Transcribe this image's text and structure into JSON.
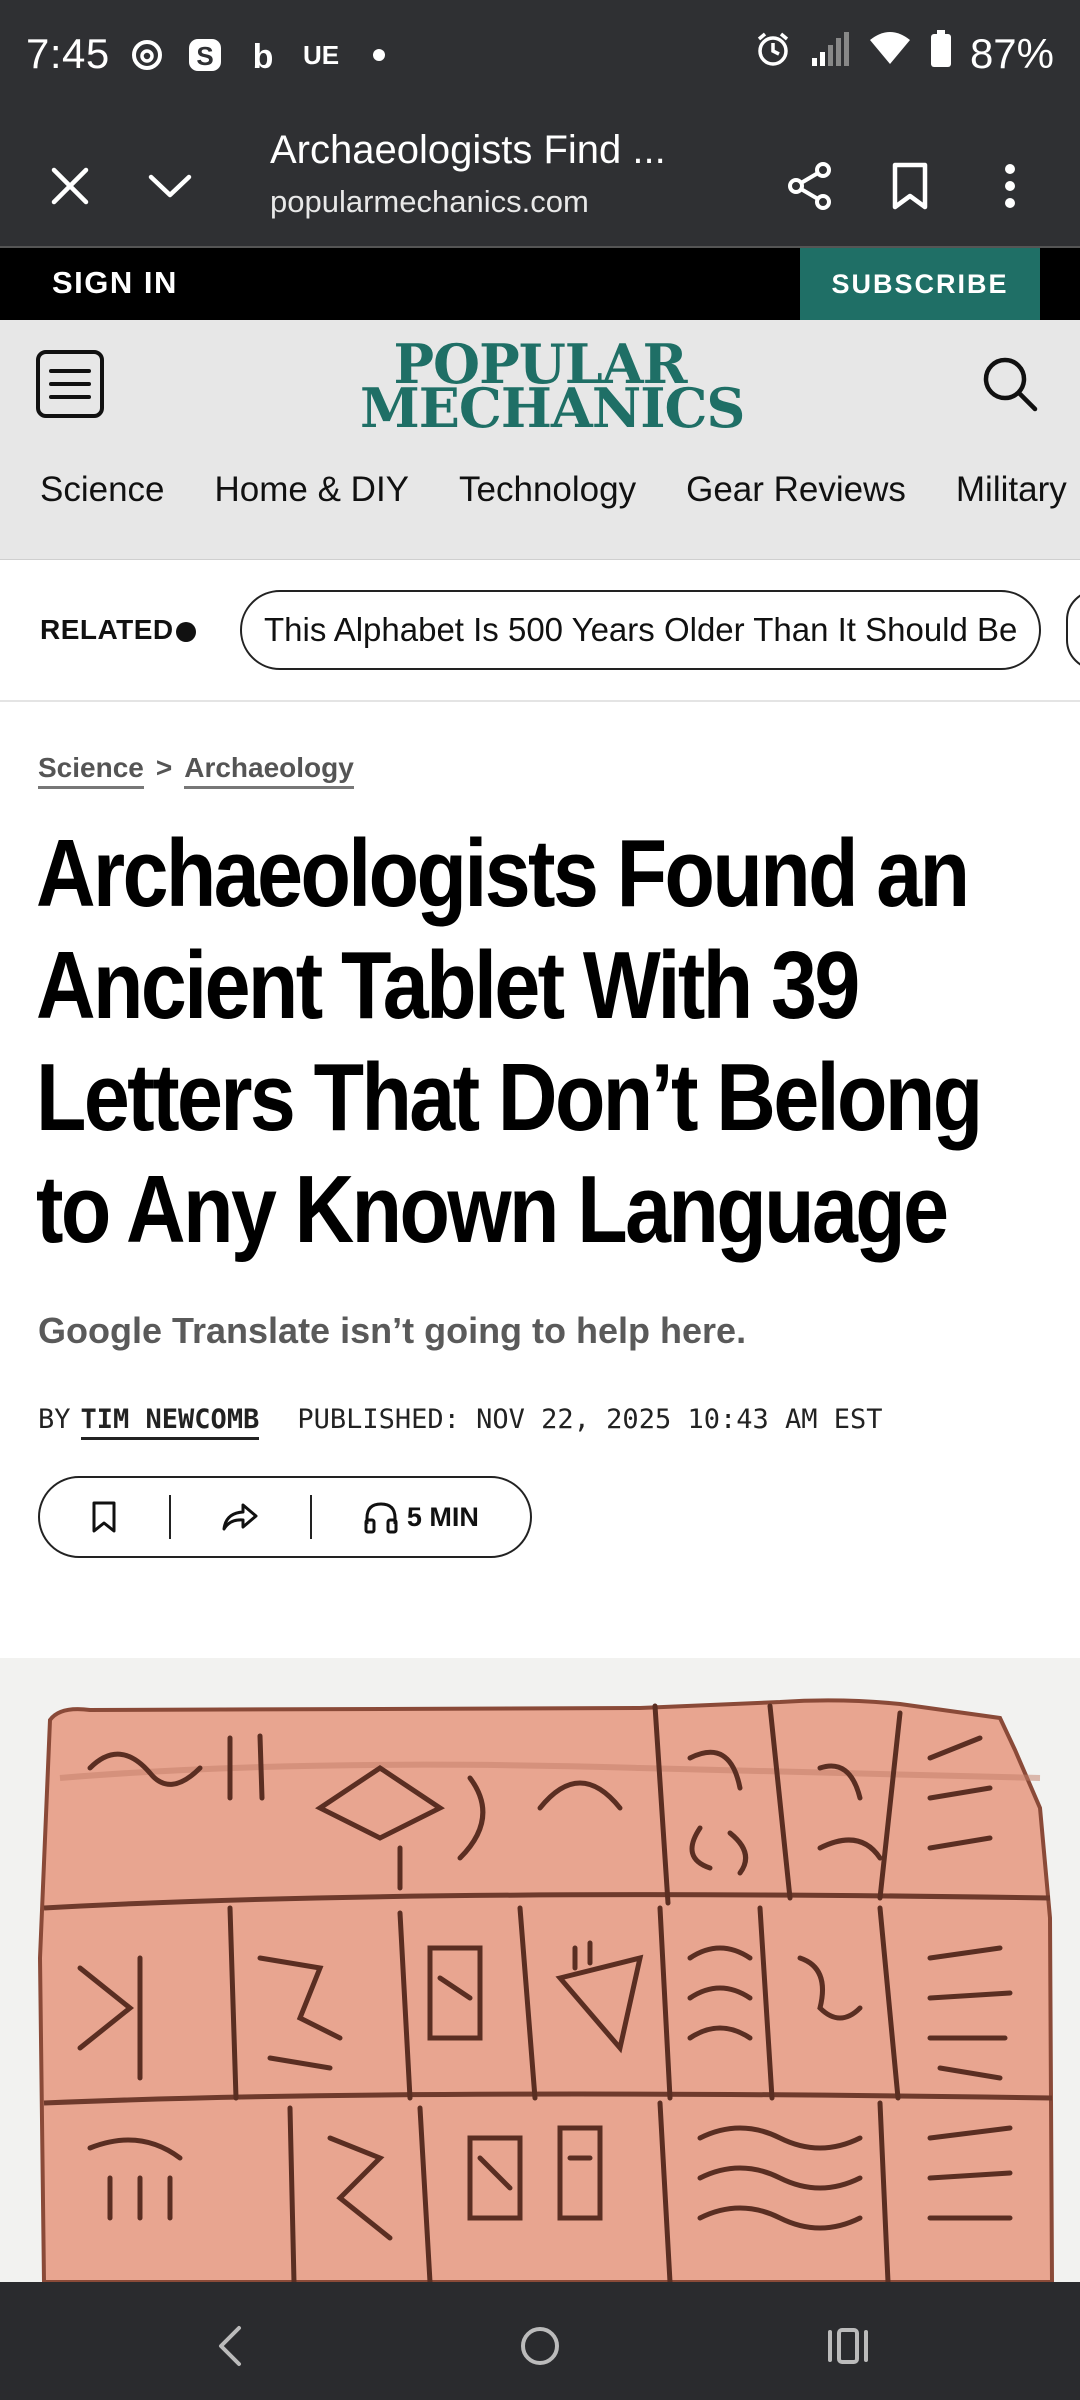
{
  "status_bar": {
    "time": "7:45",
    "left_icons": [
      "threads-icon",
      "s-app-icon",
      "b-app-icon",
      "ue-app-icon",
      "dot-icon"
    ],
    "ue_label": "UE",
    "battery": "87%"
  },
  "browser": {
    "title": "Archaeologists Find ...",
    "url": "popularmechanics.com"
  },
  "top_bar": {
    "sign_in": "SIGN IN",
    "subscribe": "SUBSCRIBE",
    "accent_color": "#1f6f66"
  },
  "masthead": {
    "logo_line1": "POPULAR",
    "logo_line2": "MECHANICS",
    "nav": [
      "Science",
      "Home & DIY",
      "Technology",
      "Gear Reviews",
      "Military"
    ]
  },
  "related": {
    "label": "RELATED",
    "item": "This Alphabet Is 500 Years Older Than It Should Be"
  },
  "article": {
    "breadcrumb": [
      "Science",
      "Archaeology"
    ],
    "breadcrumb_sep": ">",
    "headline": "Archaeologists Found an Ancient Tablet With 39 Letters That Don’t Belong to Any Known Language",
    "dek": "Google Translate isn’t going to help here.",
    "by": "BY",
    "author": "TIM NEWCOMB",
    "published": "PUBLISHED: NOV 22, 2025 10:43 AM EST",
    "listen_label": "5 MIN"
  }
}
